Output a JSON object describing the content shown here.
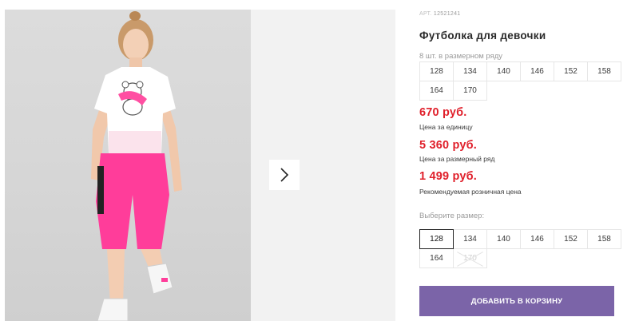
{
  "product": {
    "art_label": "АРТ.",
    "art_number": "12521241",
    "title": "Футболка для девочки",
    "pack_note": "8 шт. в размерном ряду",
    "pack_sizes": [
      "128",
      "134",
      "140",
      "146",
      "152",
      "158",
      "164",
      "170"
    ]
  },
  "prices": {
    "unit_price": "670 руб.",
    "unit_caption": "Цена за единицу",
    "pack_price": "5 360 руб.",
    "pack_caption": "Цена за размерный ряд",
    "retail_price": "1 499 руб.",
    "retail_caption": "Рекомендуемая розничная цена",
    "accent_color": "#e0202b"
  },
  "size_picker": {
    "label": "Выберите размер:",
    "sizes": [
      "128",
      "134",
      "140",
      "146",
      "152",
      "158",
      "164",
      "170"
    ],
    "selected": "128",
    "unavailable": [
      "170"
    ]
  },
  "cart": {
    "button_label": "ДОБАВИТЬ В КОРЗИНУ",
    "button_color": "#7b64a8"
  },
  "gallery": {
    "next_icon": "chevron-right-icon",
    "photo_colors": {
      "shirt": "#ffffff",
      "shorts": "#ff3d9a",
      "background": "#d6d6d6"
    }
  }
}
